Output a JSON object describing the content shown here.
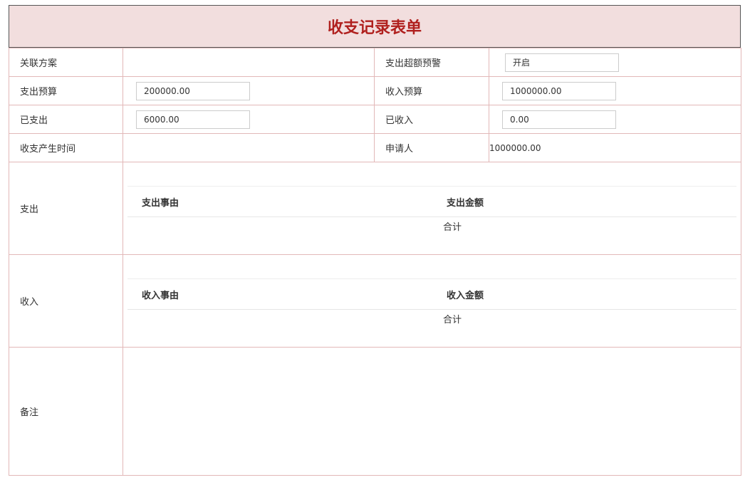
{
  "title": "收支记录表单",
  "rows": {
    "plan_label": "关联方案",
    "overrun_label": "支出超额预警",
    "overrun_value": "开启",
    "expense_budget_label": "支出预算",
    "expense_budget_value": "200000.00",
    "income_budget_label": "收入预算",
    "income_budget_value": "1000000.00",
    "spent_label": "已支出",
    "spent_value": "6000.00",
    "received_label": "已收入",
    "received_value": "0.00",
    "time_label": "收支产生时间",
    "applicant_label": "申请人",
    "applicant_value": "1000000.00"
  },
  "expense": {
    "label": "支出",
    "col_reason": "支出事由",
    "col_amount": "支出金额",
    "total": "合计"
  },
  "income": {
    "label": "收入",
    "col_reason": "收入事由",
    "col_amount": "收入金额",
    "total": "合计"
  },
  "remark": {
    "label": "备注"
  }
}
